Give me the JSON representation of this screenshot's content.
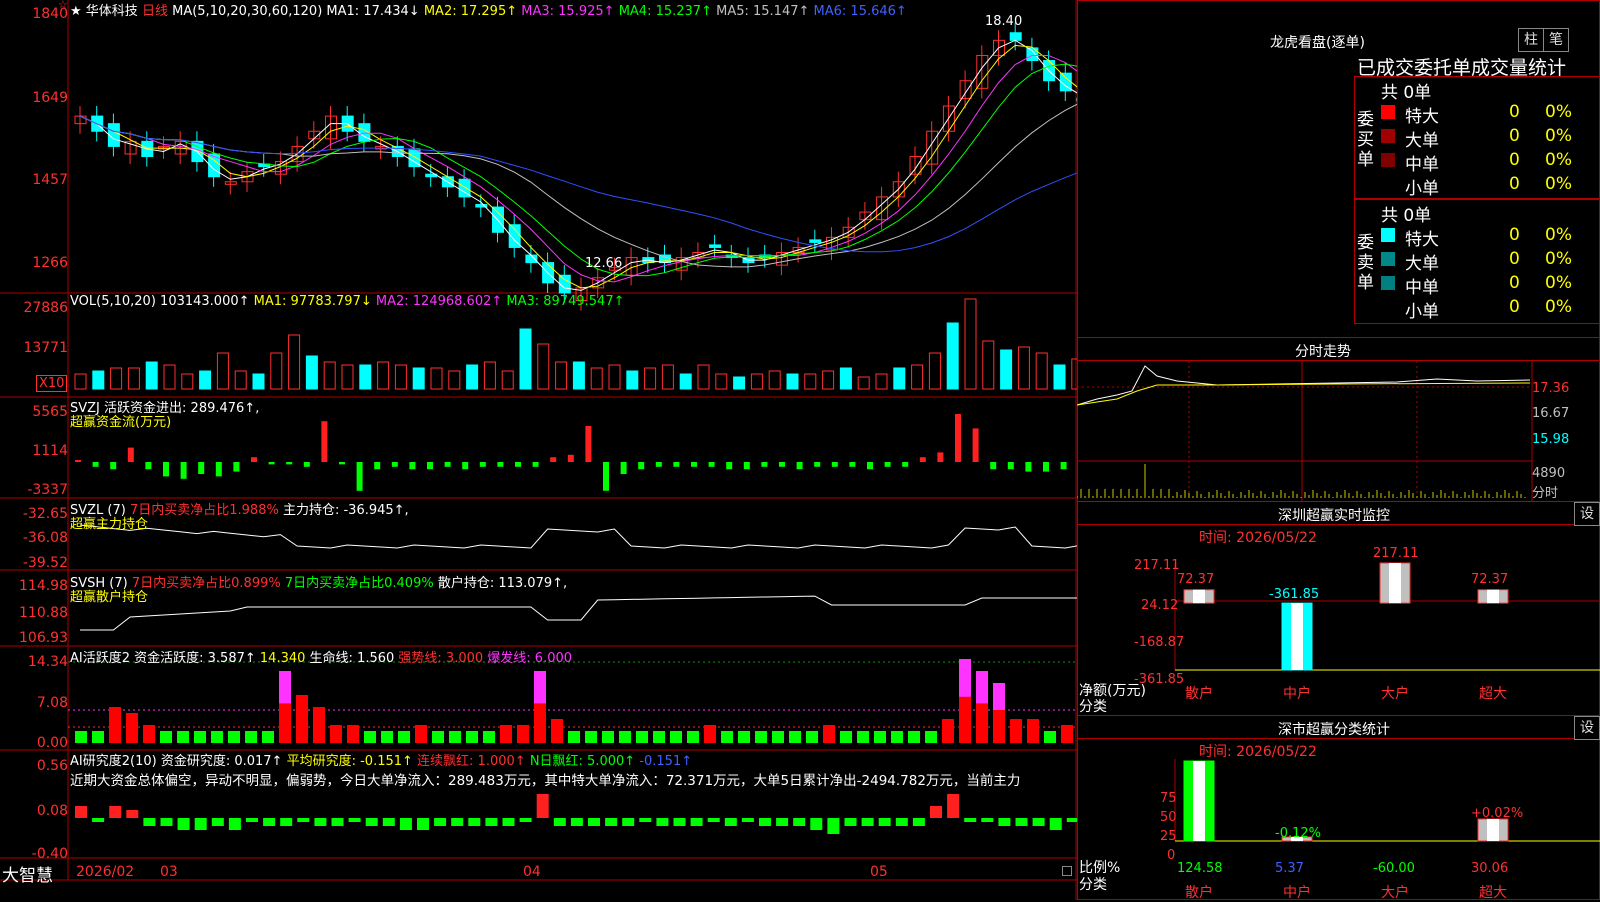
{
  "stock": {
    "star": "★",
    "menu_mark": "☆",
    "name": "华体科技",
    "period": "日线",
    "ma_label": "MA(5,10,20,30,60,120)",
    "ma": [
      {
        "t": "MA1: 17.434↓",
        "c": "#ffffff"
      },
      {
        "t": "MA2: 17.295↑",
        "c": "#ffff00"
      },
      {
        "t": "MA3: 15.925↑",
        "c": "#ff33ff"
      },
      {
        "t": "MA4: 15.237↑",
        "c": "#00ff00"
      },
      {
        "t": "MA5: 15.147↑",
        "c": "#c0c0c0"
      },
      {
        "t": "MA6: 15.646↑",
        "c": "#3050ff"
      }
    ],
    "price_axis": [
      "1840",
      "1649",
      "1457",
      "1266"
    ],
    "max_label": "18.40",
    "min_label": "12.66"
  },
  "vol": {
    "label": "VOL(5,10,20)",
    "value": "103143.000↑",
    "ma1": "MA1: 97783.797↓",
    "ma2": "MA2: 124968.602↑",
    "ma3": "MA3: 89749.547↑",
    "axis": [
      "27886",
      "13771"
    ],
    "unit": "X10",
    "bars": [
      5,
      6,
      7,
      7,
      9,
      8,
      5,
      6,
      12,
      6,
      5,
      12,
      18,
      11,
      9,
      8,
      8,
      9,
      8,
      7,
      7,
      6,
      8,
      9,
      6,
      20,
      15,
      9,
      9,
      7,
      8,
      6,
      7,
      8,
      5,
      8,
      5,
      4,
      5,
      6,
      5,
      5,
      6,
      7,
      4,
      5,
      7,
      8,
      12,
      22,
      30,
      16,
      13,
      14,
      12,
      8,
      10,
      12
    ]
  },
  "svzj": {
    "label": "SVZJ",
    "title": "活跃资金进出: 289.476↑,",
    "subtitle": "超赢资金流(万元)",
    "axis": [
      "5565",
      "1114",
      "-3337"
    ],
    "flows": [
      0,
      -2,
      -3,
      6,
      -3,
      -6,
      -7,
      -5,
      -6,
      -4,
      2,
      -1,
      -1,
      -2,
      17,
      -1,
      -12,
      -3,
      -2,
      -3,
      -3,
      -2,
      -3,
      -2,
      -2,
      -2,
      -2,
      2,
      3,
      15,
      -12,
      -5,
      -3,
      -2,
      -2,
      -2,
      -2,
      -3,
      -3,
      -2,
      -2,
      -3,
      -2,
      -2,
      -2,
      -3,
      -2,
      -2,
      2,
      4,
      20,
      14,
      -3,
      -3,
      -4,
      -4,
      -3,
      2
    ]
  },
  "svzl": {
    "label": "SVZL (7)",
    "t1": "7日内买卖净占比1.988%",
    "t2": "主力持仓: -36.945↑,",
    "subtitle": "超赢主力持仓",
    "axis": [
      "-32.65",
      "-36.08",
      "-39.52"
    ]
  },
  "svsh": {
    "label": "SVSH (7)",
    "t1": "7日内买卖净占比0.899%",
    "t2": "7日内买卖净占比0.409%",
    "t3": "散户持仓: 113.079↑,",
    "subtitle": "超赢散户持仓",
    "axis": [
      "114.98",
      "110.88",
      "106.93"
    ]
  },
  "ai2": {
    "label": "AI活跃度2",
    "t1": "资金活跃度: 3.587↑",
    "t2": "14.340",
    "t3": "生命线: 1.560",
    "t4": "强势线: 3.000",
    "t5": "爆发线: 6.000",
    "axis": [
      "14.34",
      "7.08",
      "0.00"
    ],
    "vals": [
      2,
      2,
      6,
      5,
      3,
      2,
      2,
      2,
      2,
      2,
      2,
      2,
      12,
      8,
      6,
      3,
      3,
      2,
      2,
      2,
      3,
      2,
      2,
      2,
      2,
      3,
      3,
      12,
      4,
      2,
      2,
      2,
      2,
      2,
      2,
      2,
      2,
      3,
      2,
      2,
      2,
      2,
      2,
      2,
      3,
      2,
      2,
      2,
      2,
      2,
      2,
      4,
      14,
      12,
      10,
      4,
      4,
      2,
      3,
      2
    ]
  },
  "ai_res": {
    "label": "AI研究度2(10)",
    "t1": "资金研究度: 0.017↑",
    "t2": "平均研究度: -0.151↑",
    "t3": "连续飘红: 1.000↑",
    "t4": "N日飘红: 5.000↑",
    "t5": "-0.151↑",
    "axis": [
      "0.56",
      "0.08",
      "-0.40"
    ],
    "note": "近期大资金总体偏空，异动不明显，偏弱势，今日大单净流入：289.483万元，其中特大单净流入：72.371万元，大单5日累计净出-2494.782万元，当前主力",
    "vals": [
      3,
      -1,
      3,
      2,
      -2,
      -2,
      -3,
      -3,
      -2,
      -3,
      -1,
      -2,
      -2,
      -1,
      -2,
      -2,
      -1,
      -2,
      -2,
      -3,
      -3,
      -2,
      -2,
      -2,
      -2,
      -2,
      -1,
      6,
      -2,
      -2,
      -2,
      -2,
      -2,
      -1,
      -2,
      -2,
      -2,
      -1,
      -2,
      -1,
      -2,
      -2,
      -2,
      -3,
      -4,
      -2,
      -2,
      -2,
      -2,
      -2,
      3,
      6,
      -1,
      -1,
      -2,
      -2,
      -2,
      -3,
      -1
    ]
  },
  "date_axis": {
    "brand": "大智慧",
    "labels": [
      "2026/02",
      "03",
      "04",
      "05"
    ]
  },
  "order": {
    "title": "龙虎看盘(逐单)",
    "btn_bar": "柱",
    "btn_pen": "笔",
    "header": "已成交委托单成交量统计",
    "buy_side": "委买单",
    "sell_side": "委卖单",
    "buy_total": "共 0单",
    "sell_total": "共 0单",
    "rows": [
      {
        "n": "特大",
        "v": "0",
        "p": "0%"
      },
      {
        "n": "大单",
        "v": "0",
        "p": "0%"
      },
      {
        "n": "中单",
        "v": "0",
        "p": "0%"
      },
      {
        "n": "小单",
        "v": "0",
        "p": "0%"
      }
    ],
    "buy_colors": [
      "#ff0000",
      "#a00000",
      "#800000",
      "#000000"
    ],
    "sell_colors": [
      "#00ffff",
      "#008888",
      "#008080",
      "#000000"
    ]
  },
  "intraday": {
    "title": "分时走势",
    "axis": [
      "17.36",
      "16.67",
      "15.98",
      "4890"
    ],
    "unit": "分时"
  },
  "monitor": {
    "title": "深圳超赢实时监控",
    "date": "时间: 2026/05/22",
    "btn": "设",
    "axis": [
      "217.11",
      "24.12",
      "-168.87",
      "-361.85"
    ],
    "ylabel": "净额(万元)",
    "xlabel": "分类",
    "cats": [
      "散户",
      "中户",
      "大户",
      "超大"
    ],
    "values": [
      72.37,
      -361.85,
      217.11,
      72.37
    ],
    "labels": [
      "72.37",
      "-361.85",
      "217.11",
      "72.37"
    ]
  },
  "classify": {
    "title": "深市超赢分类统计",
    "date": "时间: 2026/05/22",
    "btn": "设",
    "axis": [
      "75",
      "50",
      "25",
      "0"
    ],
    "ylabel": "比例%",
    "xlabel": "分类",
    "cats": [
      "散户",
      "中户",
      "大户",
      "超大"
    ],
    "values": [
      "124.58",
      "5.37",
      "-60.00",
      "30.06"
    ],
    "tops": [
      "",
      "-0.12%",
      "",
      "+0.02%"
    ]
  }
}
